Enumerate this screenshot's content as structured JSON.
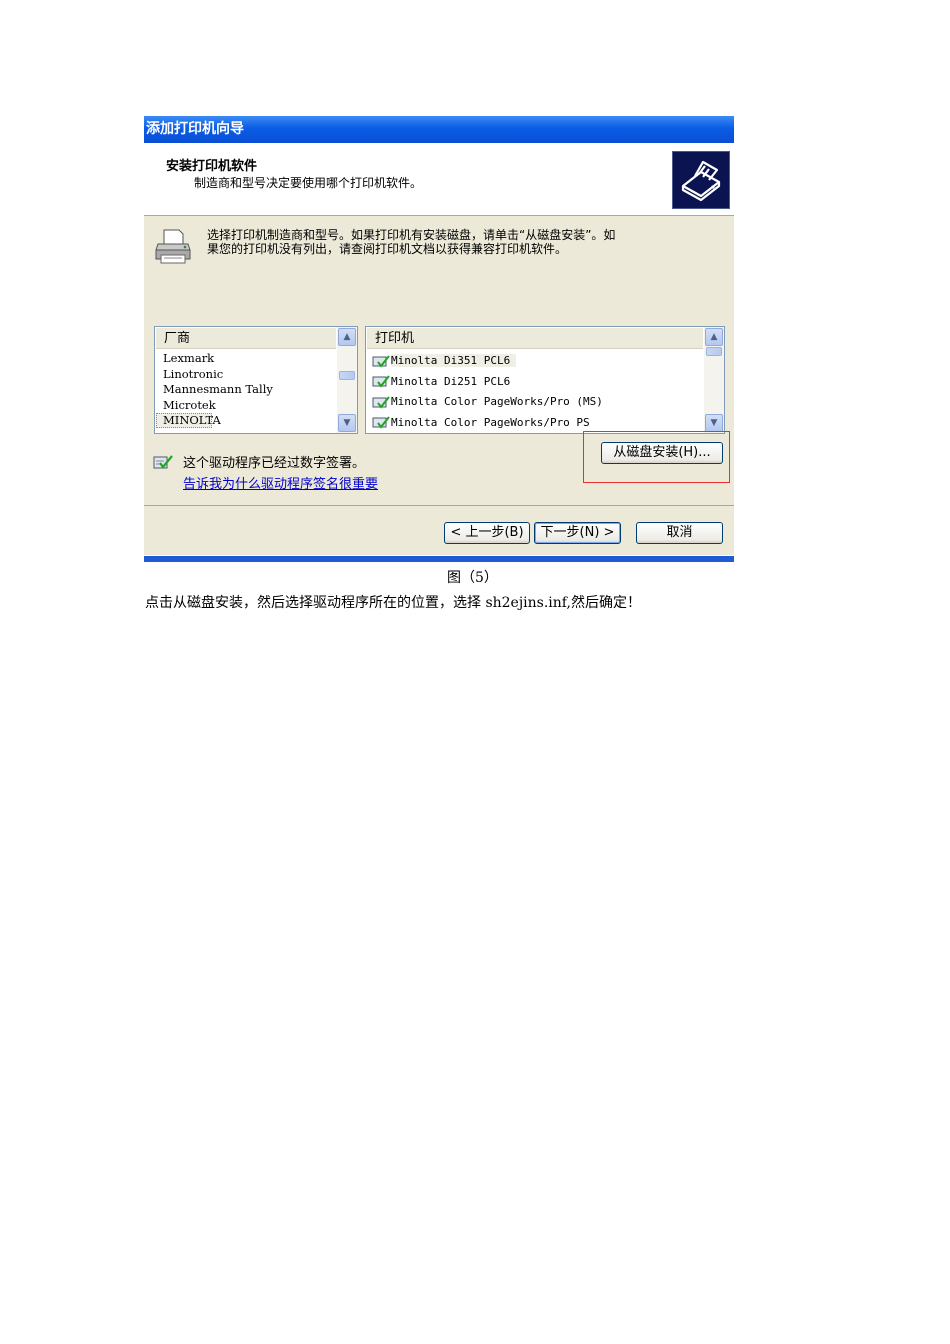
{
  "dialog": {
    "title": "添加打印机向导",
    "header_title": "安装打印机软件",
    "header_subtitle": "制造商和型号决定要使用哪个打印机软件。",
    "instruction_line1": "选择打印机制造商和型号。如果打印机有安装磁盘，请单击“从磁盘安装”。如",
    "instruction_line2": "果您的打印机没有列出，请查阅打印机文档以获得兼容打印机软件。",
    "manufacturer_list": {
      "header": "厂商",
      "items": [
        "Lexmark",
        "Linotronic",
        "Mannesmann Tally",
        "Microtek",
        "MINOLTA"
      ],
      "selected": "MINOLTA"
    },
    "printer_list": {
      "header": "打印机",
      "items": [
        "Minolta Di351 PCL6",
        "Minolta Di251 PCL6",
        "Minolta Color PageWorks/Pro (MS)",
        "Minolta Color PageWorks/Pro PS"
      ],
      "selected": "Minolta Di351 PCL6"
    },
    "signed_text": "这个驱动程序已经过数字签署。",
    "signed_link": "告诉我为什么驱动程序签名很重要",
    "buttons": {
      "have_disk": "从磁盘安装(H)...",
      "back": "< 上一步(B)",
      "next": "下一步(N) >",
      "cancel": "取消"
    }
  },
  "caption": "图（5）",
  "body_text": "点击从磁盘安装，然后选择驱动程序所在的位置，选择 sh2ejins.inf,然后确定！",
  "colors": {
    "title_bar": "#0b5ce5",
    "highlight": "#e8302c",
    "link": "#0000cc",
    "dialog_bg": "#ece9d8"
  },
  "icons": [
    "printer-icon",
    "wizard-printer-icon",
    "signed-driver-icon",
    "scroll-up-icon",
    "scroll-down-icon"
  ]
}
